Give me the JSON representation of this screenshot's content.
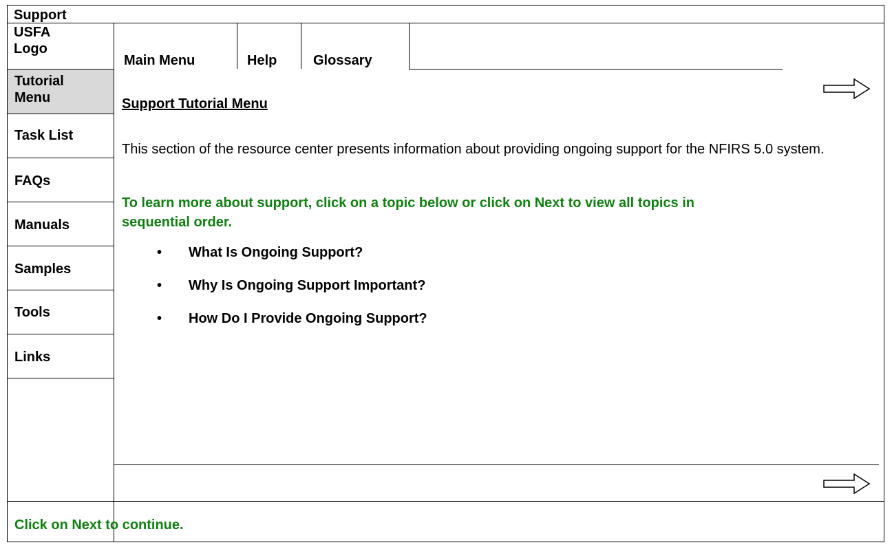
{
  "header": {
    "section_title": "Support"
  },
  "logo": {
    "line1": "USFA",
    "line2": "Logo"
  },
  "nav": {
    "main_menu": "Main Menu",
    "help": "Help",
    "glossary": "Glossary"
  },
  "sidebar": {
    "items": [
      {
        "line1": "Tutorial",
        "line2": "Menu"
      },
      {
        "label": "Task List"
      },
      {
        "label": "FAQs"
      },
      {
        "label": "Manuals"
      },
      {
        "label": "Samples"
      },
      {
        "label": "Tools"
      },
      {
        "label": "Links"
      }
    ]
  },
  "content": {
    "heading": "Support Tutorial Menu",
    "intro": "This section of the resource center presents information about providing ongoing support for the NFIRS 5.0 system.",
    "prompt": "To learn more about support, click on a topic below or click on Next to view all topics in sequential order.",
    "topics": [
      "What Is Ongoing Support?",
      "Why Is Ongoing Support Important?",
      "How Do I Provide Ongoing Support?"
    ],
    "bullet_glyph": "•"
  },
  "footer": {
    "message": "Click on Next to continue."
  },
  "icons": {
    "next_top": "next-arrow-icon",
    "next_bottom": "next-arrow-icon"
  },
  "colors": {
    "prompt_green": "#108010",
    "active_sidebar_bg": "#d9d9d9"
  }
}
